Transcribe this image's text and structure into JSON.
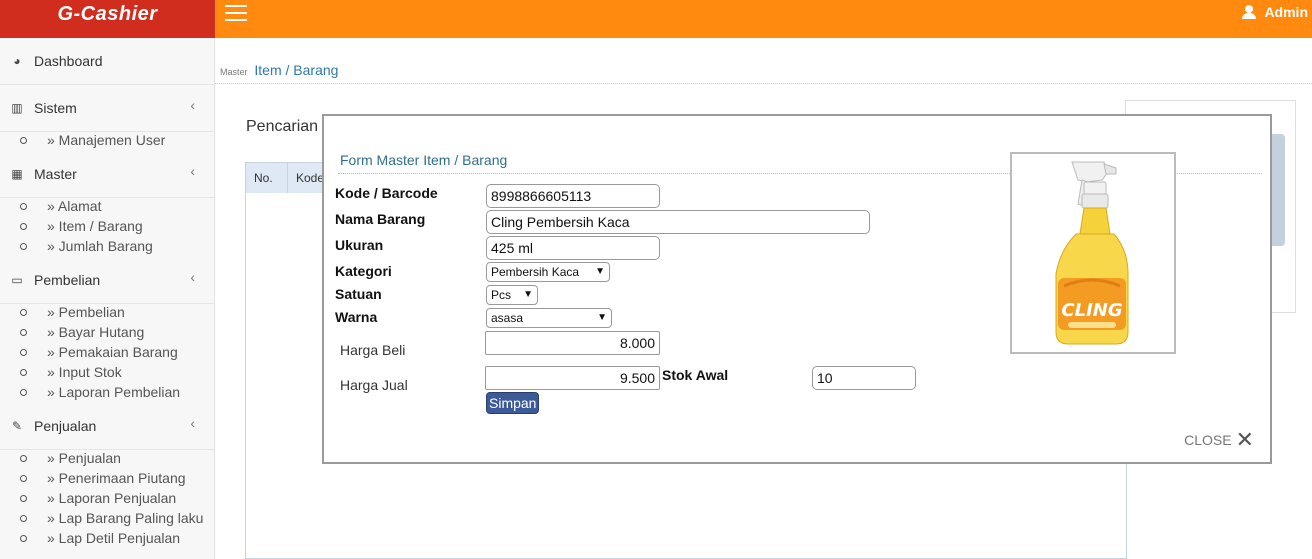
{
  "app": {
    "brand": "G-Cashier",
    "user": "Admin"
  },
  "breadcrumb": {
    "section": "Master",
    "page": "Item / Barang"
  },
  "sidebar": {
    "dashboard": "Dashboard",
    "sistem": {
      "label": "Sistem",
      "items": [
        "» Manajemen User"
      ]
    },
    "master": {
      "label": "Master",
      "items": [
        "» Alamat",
        "» Item / Barang",
        "» Jumlah Barang"
      ]
    },
    "pembelian": {
      "label": "Pembelian",
      "items": [
        "» Pembelian",
        "» Bayar Hutang",
        "» Pemakaian Barang",
        "» Input Stok",
        "» Laporan Pembelian"
      ]
    },
    "penjualan": {
      "label": "Penjualan",
      "items": [
        "» Penjualan",
        "» Penerimaan Piutang",
        "» Laporan Penjualan",
        "» Lap Barang Paling laku",
        "» Lap Detil Penjualan"
      ]
    }
  },
  "main": {
    "search_label": "Pencarian",
    "columns": [
      "No.",
      "Kode"
    ]
  },
  "modal": {
    "title": "Form Master Item / Barang",
    "fields": {
      "kode_label": "Kode / Barcode",
      "kode_value": "8998866605113",
      "nama_label": "Nama Barang",
      "nama_value": "Cling Pembersih Kaca",
      "ukuran_label": "Ukuran",
      "ukuran_value": "425 ml",
      "kategori_label": "Kategori",
      "kategori_value": "Pembersih Kaca",
      "satuan_label": "Satuan",
      "satuan_value": "Pcs",
      "warna_label": "Warna",
      "warna_value": "asasa",
      "beli_label": "Harga Beli",
      "beli_value": "8.000",
      "jual_label": "Harga Jual",
      "jual_value": "9.500",
      "stok_label": "Stok Awal",
      "stok_value": "10"
    },
    "save_label": "Simpan",
    "close_label": "CLOSE",
    "product_image_text": "CLING"
  },
  "colors": {
    "topbar": "#ff8a0f",
    "brand": "#d12d1e",
    "button": "#3d5a98"
  }
}
